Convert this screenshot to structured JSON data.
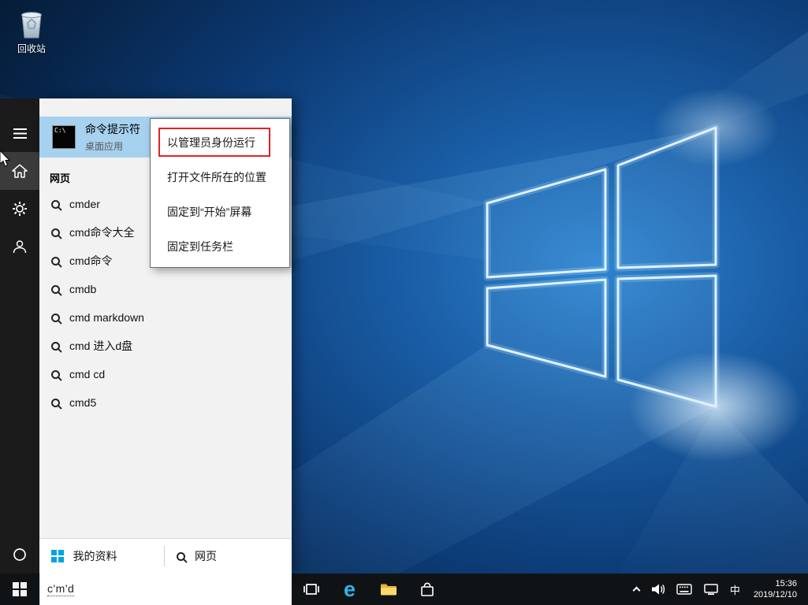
{
  "desktop": {
    "recycle_bin_label": "回收站"
  },
  "start_menu": {
    "top_result": {
      "title": "命令提示符",
      "subtitle": "桌面应用"
    },
    "section_header": "网页",
    "suggestions": [
      "cmder",
      "cmd命令大全",
      "cmd命令",
      "cmdb",
      "cmd markdown",
      "cmd 进入d盘",
      "cmd cd",
      "cmd5"
    ],
    "footer": {
      "my_stuff": "我的资料",
      "web": "网页"
    },
    "search_value": "c'm'd"
  },
  "context_menu": {
    "items": [
      {
        "label": "以管理员身份运行",
        "highlighted": true
      },
      {
        "label": "打开文件所在的位置",
        "highlighted": false
      },
      {
        "label": "固定到“开始”屏幕",
        "highlighted": false
      },
      {
        "label": "固定到任务栏",
        "highlighted": false
      }
    ]
  },
  "taskbar": {
    "ime_indicator": "中",
    "clock": {
      "time": "15:36",
      "date": "2019/12/10"
    }
  },
  "icons": {
    "command_prompt_glyph": "C:\\",
    "edge_glyph": "e"
  },
  "colors": {
    "top_result_highlight": "#a6d1ef",
    "red_outline": "#e02424",
    "sidebar_bg": "#1b1b1b",
    "panel_bg": "#f2f2f2",
    "taskbar_bg": "#101316",
    "edge_blue": "#2fb4ea",
    "windows_flag_blue": "#00a3e6",
    "folder_yellow": "#f7c94c"
  }
}
